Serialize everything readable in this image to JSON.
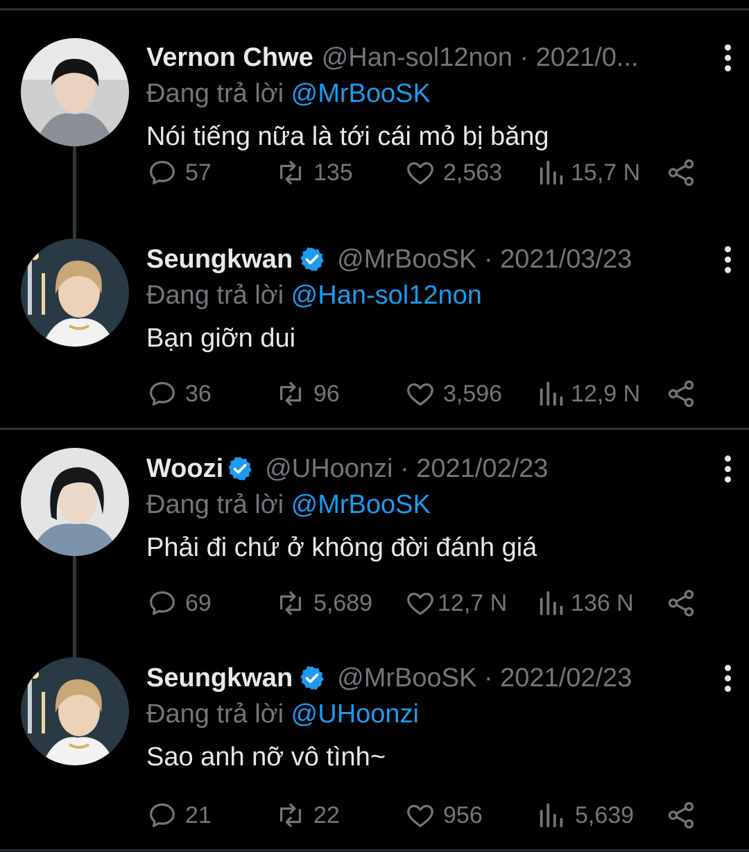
{
  "tweets": [
    {
      "name": "Vernon Chwe",
      "verified": false,
      "meta": "@Han-sol12non · 2021/0...",
      "reply_prefix": "Đang trả lời ",
      "reply_to": "@MrBooSK",
      "text": "Nói tiếng nữa là tới cái mỏ bị băng",
      "replies": "57",
      "retweets": "135",
      "likes": "2,563",
      "views": "15,7 N"
    },
    {
      "name": "Seungkwan",
      "verified": true,
      "meta": "@MrBooSK · 2021/03/23",
      "reply_prefix": "Đang trả lời ",
      "reply_to": "@Han-sol12non",
      "text": "Bạn giỡn dui",
      "replies": "36",
      "retweets": "96",
      "likes": "3,596",
      "views": "12,9 N"
    },
    {
      "name": "Woozi",
      "verified": true,
      "meta": "@UHoonzi · 2021/02/23",
      "reply_prefix": "Đang trả lời ",
      "reply_to": "@MrBooSK",
      "text": "Phải đi chứ ở không đời đánh giá",
      "replies": "69",
      "retweets": "5,689",
      "likes": "12,7 N",
      "views": "136 N"
    },
    {
      "name": "Seungkwan",
      "verified": true,
      "meta": "@MrBooSK · 2021/02/23",
      "reply_prefix": "Đang trả lời ",
      "reply_to": "@UHoonzi",
      "text": "Sao anh nỡ vô tình~",
      "replies": "21",
      "retweets": "22",
      "likes": "956",
      "views": "5,639"
    }
  ],
  "colors": {
    "background": "#000000",
    "primary_text": "#e7e9ea",
    "secondary_text": "#71767b",
    "accent": "#1d9bf0",
    "divider": "#2f3336"
  }
}
